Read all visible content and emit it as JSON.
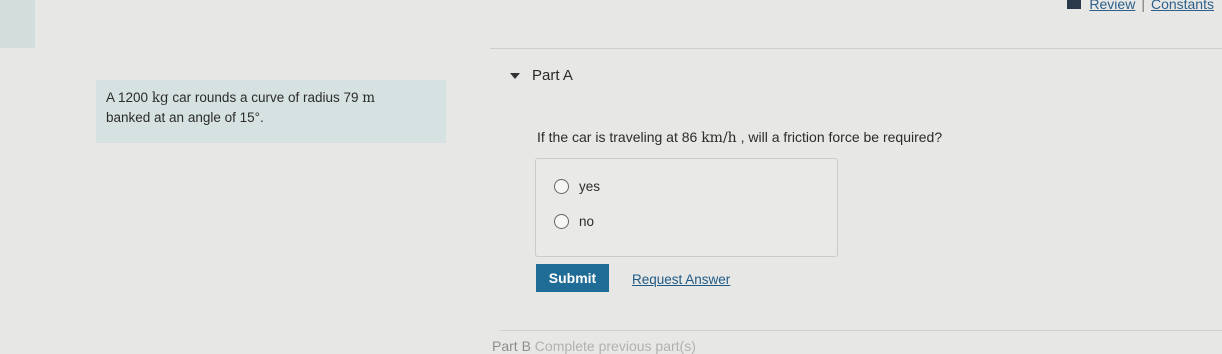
{
  "toolbar": {
    "icon": "book-icon",
    "review_label": "Review",
    "separator": "|",
    "constants_label": "Constants"
  },
  "problem": {
    "line1_prefix": "A 1200",
    "line1_unit1": "kg",
    "line1_middle": "car rounds a curve of radius 79",
    "line1_unit2": "m",
    "line2_prefix": "banked at an angle of 15",
    "line2_unit": "°",
    "line2_suffix": "."
  },
  "part_a": {
    "title": "Part A",
    "question_prefix": "If the car is traveling at 86",
    "question_unit": "km/h",
    "question_suffix": ", will a friction force be required?",
    "options": [
      "yes",
      "no"
    ],
    "submit_label": "Submit",
    "request_answer_label": "Request Answer"
  },
  "part_b": {
    "title": "Part B",
    "status": "Complete previous part(s)"
  },
  "colors": {
    "background": "#e7e8e5",
    "problem_box": "#d6e2e1",
    "submit_button": "#1f6c96",
    "link": "#2e5f8a"
  }
}
